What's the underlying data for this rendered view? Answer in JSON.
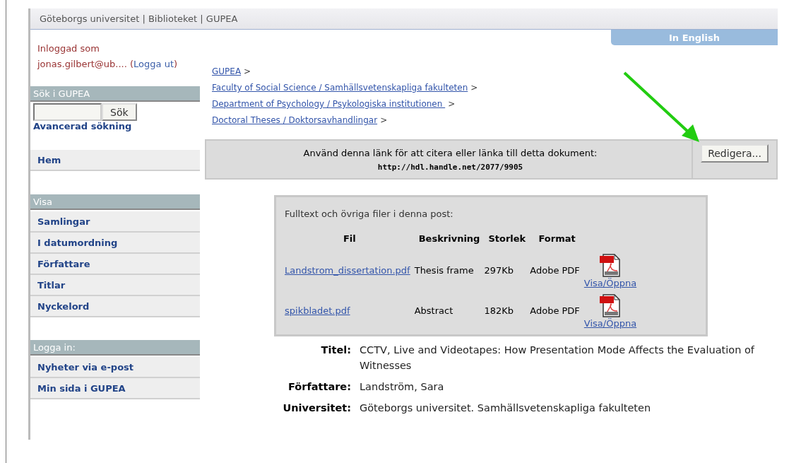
{
  "header": {
    "trail": "Göteborgs universitet | Biblioteket | GUPEA"
  },
  "language_link": "In English",
  "login": {
    "label": "Inloggad som",
    "user": "jonas.gilbert@ub.... (",
    "logout": "Logga ut",
    "after": ")"
  },
  "search": {
    "title": "Sök i GUPEA",
    "button": "Sök",
    "advanced": "Avancerad sökning"
  },
  "home": "Hem",
  "browse": {
    "title": "Visa",
    "items": [
      "Samlingar",
      "I datumordning",
      "Författare",
      "Titlar",
      "Nyckelord"
    ]
  },
  "account": {
    "title": "Logga in:",
    "items": [
      "Nyheter via e-post",
      "Min sida i GUPEA"
    ]
  },
  "breadcrumbs": {
    "separator": ">",
    "items": [
      "GUPEA",
      "Faculty of Social Science / Samhällsvetenskapliga fakulteten",
      "Department of Psychology / Psykologiska institutionen ",
      "Doctoral Theses / Doktorsavhandlingar"
    ]
  },
  "citation": {
    "text": "Använd denna länk för att citera eller länka till detta dokument:",
    "url": "http://hdl.handle.net/2077/9905",
    "button": "Redigera..."
  },
  "files": {
    "title": "Fulltext och övriga filer i denna post:",
    "columns": [
      "Fil",
      "Beskrivning",
      "Storlek",
      "Format"
    ],
    "rows": [
      {
        "file": "Landstrom_dissertation.pdf",
        "description": "Thesis frame",
        "size": "297Kb",
        "format": "Adobe PDF",
        "action": "Visa/Öppna"
      },
      {
        "file": "spikbladet.pdf",
        "description": "Abstract",
        "size": "182Kb",
        "format": "Adobe PDF",
        "action": "Visa/Öppna"
      }
    ]
  },
  "metadata": [
    {
      "label": "Titel:",
      "value": "CCTV, Live and Videotapes: How Presentation Mode Affects the Evaluation of Witnesses"
    },
    {
      "label": "Författare:",
      "value": "Landström, Sara"
    },
    {
      "label": "Universitet:",
      "value": "Göteborgs universitet. Samhällsvetenskapliga fakulteten"
    }
  ]
}
